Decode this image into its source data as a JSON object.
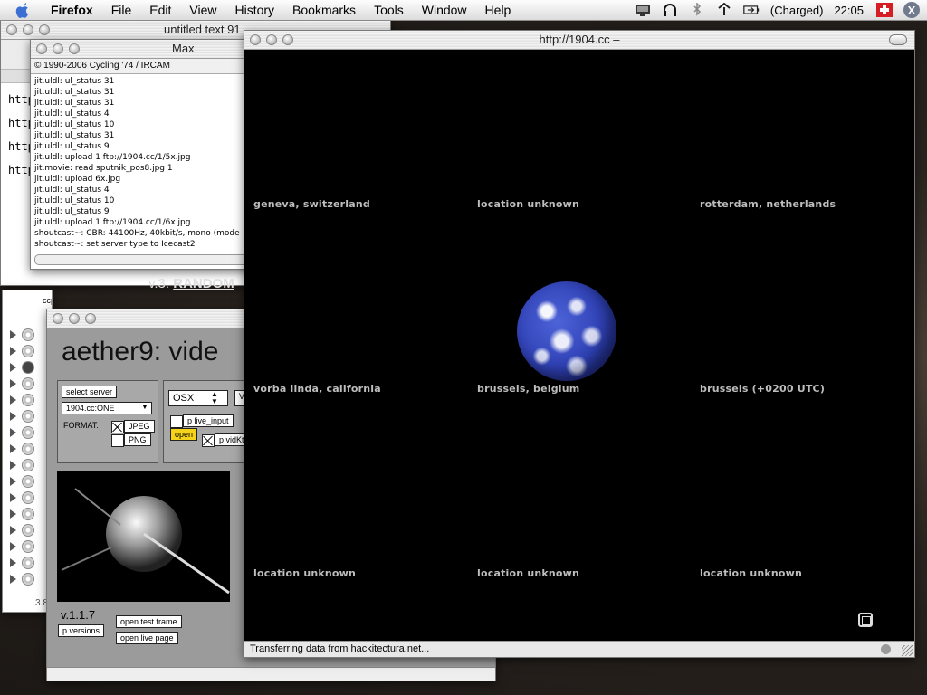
{
  "menubar": {
    "app_name": "Firefox",
    "items": [
      "File",
      "Edit",
      "View",
      "History",
      "Bookmarks",
      "Tools",
      "Window",
      "Help"
    ],
    "battery_status": "(Charged)",
    "clock": "22:05"
  },
  "untitled_window": {
    "title": "untitled text 91",
    "lines": [
      "http",
      "http",
      "http",
      "http"
    ]
  },
  "max_window": {
    "title": "Max",
    "copyright": "© 1990-2006 Cycling '74 / IRCAM",
    "log": [
      "jit.uldl: ul_status 31",
      "jit.uldl: ul_status 31",
      "jit.uldl: ul_status 31",
      "jit.uldl: ul_status 4",
      "jit.uldl: ul_status 10",
      "jit.uldl: ul_status 31",
      "jit.uldl: ul_status 9",
      "jit.uldl: upload 1 ftp://1904.cc/1/5x.jpg",
      "jit.movie: read sputnik_pos8.jpg 1",
      "jit.uldl: upload 6x.jpg",
      "jit.uldl: ul_status 4",
      "jit.uldl: ul_status 10",
      "jit.uldl: ul_status 9",
      "jit.uldl: upload 1 ftp://1904.cc/1/6x.jpg",
      "shoutcast~: CBR: 44100Hz, 40kbit/s, mono (mode",
      "shoutcast~: set server type to Icecast2"
    ]
  },
  "background_page": {
    "version_prefix": "v.3:",
    "version_link": "RANDOM"
  },
  "finder": {
    "file_name": "ccpublisher.po",
    "footer": "3.8"
  },
  "aether_window": {
    "title": "aether9: vide",
    "select_server": "select server",
    "server_value": "1904.cc:ONE",
    "format_label": "FORMAT:",
    "format_jpeg": "JPEG",
    "format_png": "PNG",
    "os_value": "OSX",
    "live_input": "p live_input",
    "open_label": "open",
    "vidkt_label": "p vidKt",
    "version": "v.1.1.7",
    "versions_button": "p versions",
    "open_test_frame": "open test frame",
    "open_live_page": "open live page"
  },
  "firefox": {
    "title": "http://1904.cc –",
    "locations": [
      "geneva, switzerland",
      "location unknown",
      "rotterdam, netherlands",
      "vorba linda, california",
      "brussels, belgium",
      "brussels (+0200 UTC)",
      "location unknown",
      "location unknown",
      "location unknown"
    ],
    "status": "Transferring data from hackitectura.net..."
  }
}
